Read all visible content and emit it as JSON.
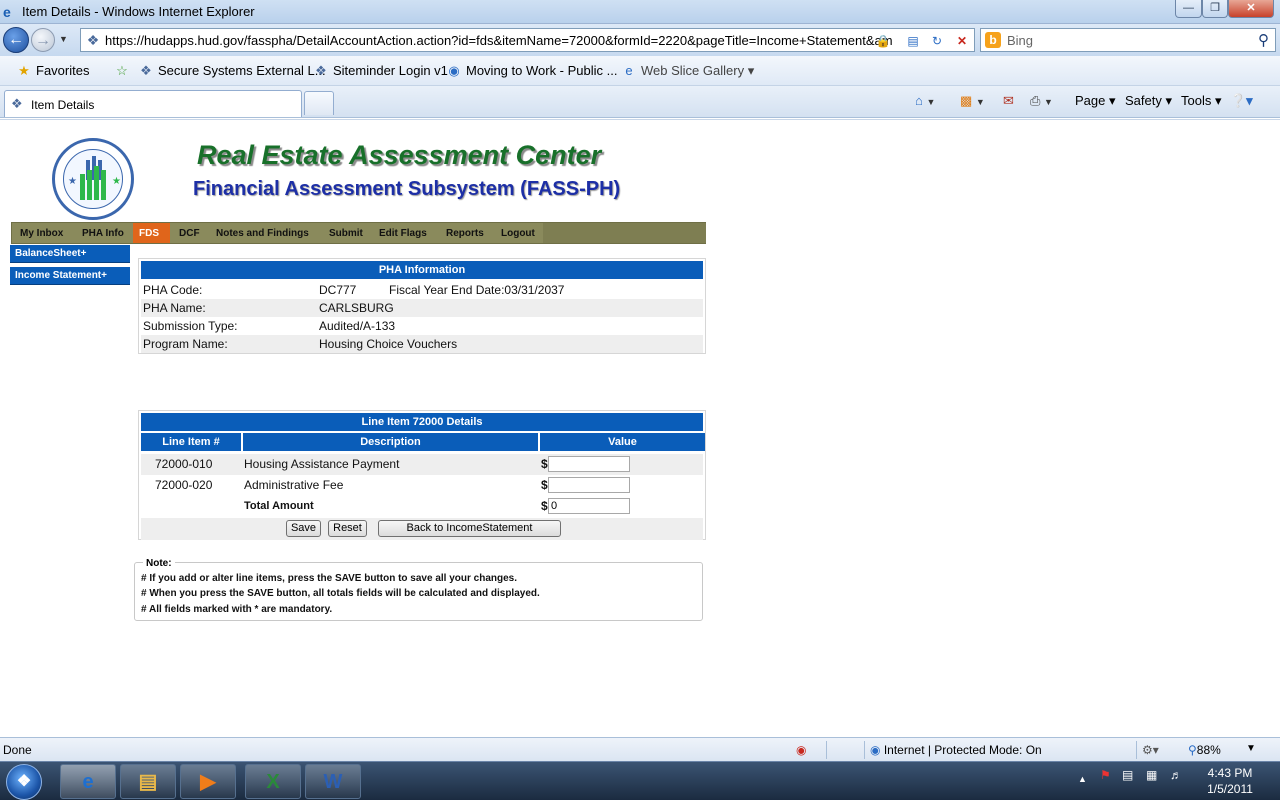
{
  "window": {
    "title": "Item Details - Windows Internet Explorer"
  },
  "address_bar": {
    "url": "https://hudapps.hud.gov/fasspha/DetailAccountAction.action?id=fds&itemName=72000&formId=2220&pageTitle=Income+Statement&am",
    "search_placeholder": "Bing"
  },
  "favorites_bar": {
    "favorites_label": "Favorites",
    "links": [
      "Secure Systems External L...",
      "Siteminder Login v1",
      "Moving to Work - Public ...",
      "Web Slice Gallery"
    ]
  },
  "tabs": [
    {
      "label": "Item Details"
    }
  ],
  "command_bar": {
    "page": "Page",
    "safety": "Safety",
    "tools": "Tools"
  },
  "page": {
    "org_title": "Real Estate Assessment Center",
    "subsystem_title": "Financial Assessment Subsystem (FASS-PH)",
    "menu": [
      "My Inbox",
      "PHA Info",
      "FDS",
      "DCF",
      "Notes and Findings",
      "Submit",
      "Edit Flags",
      "Reports",
      "Logout"
    ],
    "active_menu": "FDS",
    "side_nav": [
      "BalanceSheet+",
      "Income Statement+"
    ],
    "pha_info": {
      "header": "PHA Information",
      "code_label": "PHA Code:",
      "code": "DC777",
      "fiscal_label": "Fiscal Year End Date:",
      "fiscal_date": "03/31/2037",
      "name_label": "PHA Name:",
      "name": "CARLSBURG",
      "submission_label": "Submission Type:",
      "submission": "Audited/A-133",
      "program_label": "Program Name:",
      "program": "Housing Choice Vouchers"
    },
    "line_items": {
      "header": "Line Item 72000 Details",
      "col_item": "Line Item #",
      "col_desc": "Description",
      "col_value": "Value",
      "currency": "$",
      "rows": [
        {
          "code": "72000-010",
          "description": "Housing Assistance Payment",
          "value": ""
        },
        {
          "code": "72000-020",
          "description": "Administrative Fee",
          "value": ""
        }
      ],
      "total_label": "Total Amount",
      "total_value": "0",
      "save_label": "Save",
      "reset_label": "Reset",
      "back_label": "Back to IncomeStatement"
    },
    "notes": {
      "title": "Note:",
      "lines": [
        "# If you add or alter line items, press the SAVE button to save all your changes.",
        "# When you press the SAVE button, all totals fields will be calculated and displayed.",
        "# All fields marked with * are mandatory."
      ]
    }
  },
  "status_bar": {
    "status": "Done",
    "zone": "Internet | Protected Mode: On",
    "zoom": "88%"
  },
  "taskbar": {
    "time": "4:43 PM",
    "date": "1/5/2011"
  },
  "colors": {
    "nav_blue": "#0a5db9",
    "menu_olive": "#8a8a5c",
    "active_orange": "#e0651b",
    "title_green": "#18702a",
    "subtitle_blue": "#1d2fa6"
  }
}
